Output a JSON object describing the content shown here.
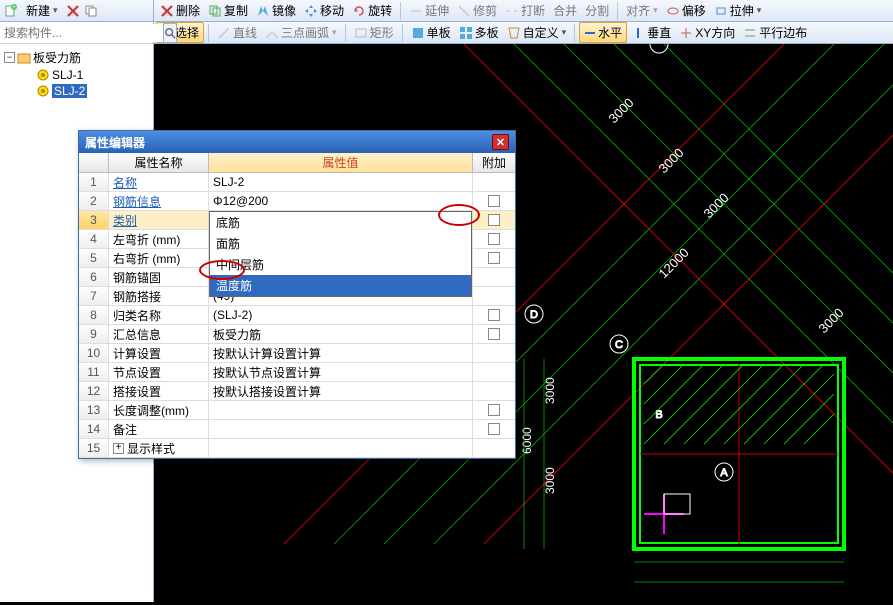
{
  "left_top": {
    "new_label": "新建"
  },
  "search": {
    "placeholder": "搜索构件..."
  },
  "tree": {
    "root_label": "板受力筋",
    "items": [
      "SLJ-1",
      "SLJ-2"
    ],
    "selected_index": 1
  },
  "toolbar": {
    "delete": "删除",
    "copy": "复制",
    "mirror": "镜像",
    "move": "移动",
    "rotate": "旋转",
    "extend": "延伸",
    "trim": "修剪",
    "break": "打断",
    "merge": "合并",
    "split": "分割",
    "align": "对齐",
    "offset": "偏移",
    "stretch": "拉伸"
  },
  "toolbar2": {
    "select": "选择",
    "line": "直线",
    "arc": "三点画弧",
    "rect": "矩形",
    "single": "单板",
    "multi": "多板",
    "custom": "自定义",
    "horiz": "水平",
    "vert": "垂直",
    "xy": "XY方向",
    "parallel": "平行边布"
  },
  "dialog": {
    "title": "属性编辑器",
    "head_name": "属性名称",
    "head_val": "属性值",
    "head_add": "附加",
    "rows": [
      {
        "n": "1",
        "name": "名称",
        "link": true,
        "val": "SLJ-2",
        "chk": false
      },
      {
        "n": "2",
        "name": "钢筋信息",
        "link": true,
        "val": "Φ12@200",
        "chk": true
      },
      {
        "n": "3",
        "name": "类别",
        "link": true,
        "val": "温度筋",
        "chk": true,
        "sel": true,
        "dd": true
      },
      {
        "n": "4",
        "name": "左弯折 (mm)",
        "link": false,
        "val": "",
        "chk": true
      },
      {
        "n": "5",
        "name": "右弯折 (mm)",
        "link": false,
        "val": "",
        "chk": true
      },
      {
        "n": "6",
        "name": "钢筋锚固",
        "link": false,
        "val": "",
        "chk": false
      },
      {
        "n": "7",
        "name": "钢筋搭接",
        "link": false,
        "val": "(49)",
        "chk": false
      },
      {
        "n": "8",
        "name": "归类名称",
        "link": false,
        "val": "(SLJ-2)",
        "chk": true
      },
      {
        "n": "9",
        "name": "汇总信息",
        "link": false,
        "val": "板受力筋",
        "chk": true
      },
      {
        "n": "10",
        "name": "计算设置",
        "link": false,
        "val": "按默认计算设置计算",
        "chk": false
      },
      {
        "n": "11",
        "name": "节点设置",
        "link": false,
        "val": "按默认节点设置计算",
        "chk": false
      },
      {
        "n": "12",
        "name": "搭接设置",
        "link": false,
        "val": "按默认搭接设置计算",
        "chk": false
      },
      {
        "n": "13",
        "name": "长度调整(mm)",
        "link": false,
        "val": "",
        "chk": true
      },
      {
        "n": "14",
        "name": "备注",
        "link": false,
        "val": "",
        "chk": true
      },
      {
        "n": "15",
        "name": "显示样式",
        "link": false,
        "val": "",
        "chk": false,
        "expand": true
      }
    ]
  },
  "dropdown": {
    "items": [
      "底筋",
      "面筋",
      "中间层筋",
      "温度筋"
    ],
    "selected_index": 3
  },
  "canvas": {
    "dims": [
      "3000",
      "3000",
      "3000",
      "12000",
      "3000",
      "6000",
      "3000",
      "3000"
    ],
    "axes": [
      "A",
      "B",
      "C",
      "D"
    ]
  }
}
